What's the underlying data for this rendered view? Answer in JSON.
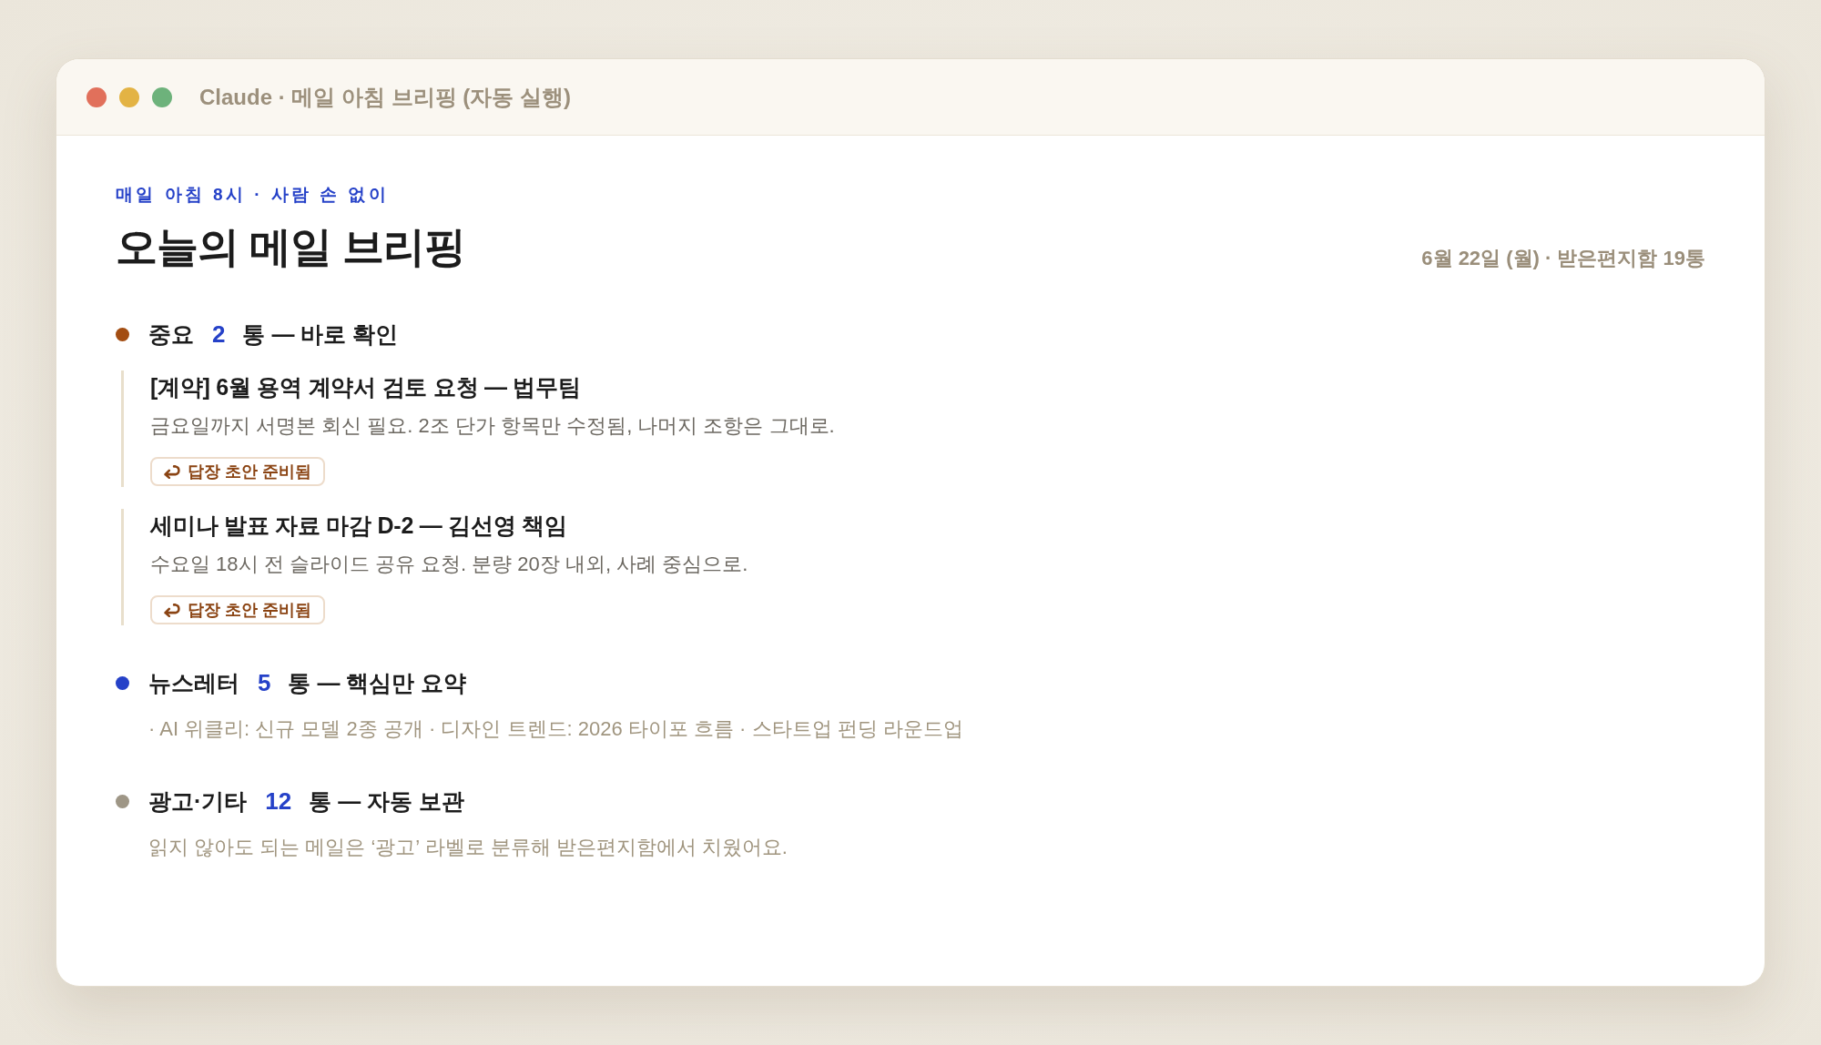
{
  "window": {
    "title": "Claude · 메일 아침 브리핑 (자동 실행)"
  },
  "header": {
    "kicker": "매일 아침 8시 · 사람 손 없이",
    "title": "오늘의 메일 브리핑",
    "meta": "6월 22일 (월) · 받은편지함 19통"
  },
  "sections": [
    {
      "kind": "emails",
      "label": "중요",
      "count": "2",
      "suffix": "통 — 바로 확인",
      "color": "#a34d12",
      "emails": [
        {
          "subject": "[계약] 6월 용역 계약서 검토 요청 — 법무팀",
          "summary": "금요일까지 서명본 회신 필요. 2조 단가 항목만 수정됨, 나머지 조항은 그대로.",
          "tag": "답장 초안 준비됨"
        },
        {
          "subject": "세미나 발표 자료 마감 D-2 — 김선영 책임",
          "summary": "수요일 18시 전 슬라이드 공유 요청. 분량 20장 내외, 사례 중심으로.",
          "tag": "답장 초안 준비됨"
        }
      ]
    },
    {
      "kind": "note",
      "label": "뉴스레터",
      "count": "5",
      "suffix": "통 — 핵심만 요약",
      "color": "#2541c8",
      "note": "· AI 위클리: 신규 모델 2종 공개 · 디자인 트렌드: 2026 타이포 흐름 · 스타트업 펀딩 라운드업"
    },
    {
      "kind": "note",
      "label": "광고·기타",
      "count": "12",
      "suffix": "통 — 자동 보관",
      "color": "#9e9686",
      "note": "읽지 않아도 되는 메일은 ‘광고’ 라벨로 분류해 받은편지함에서 치웠어요."
    }
  ]
}
